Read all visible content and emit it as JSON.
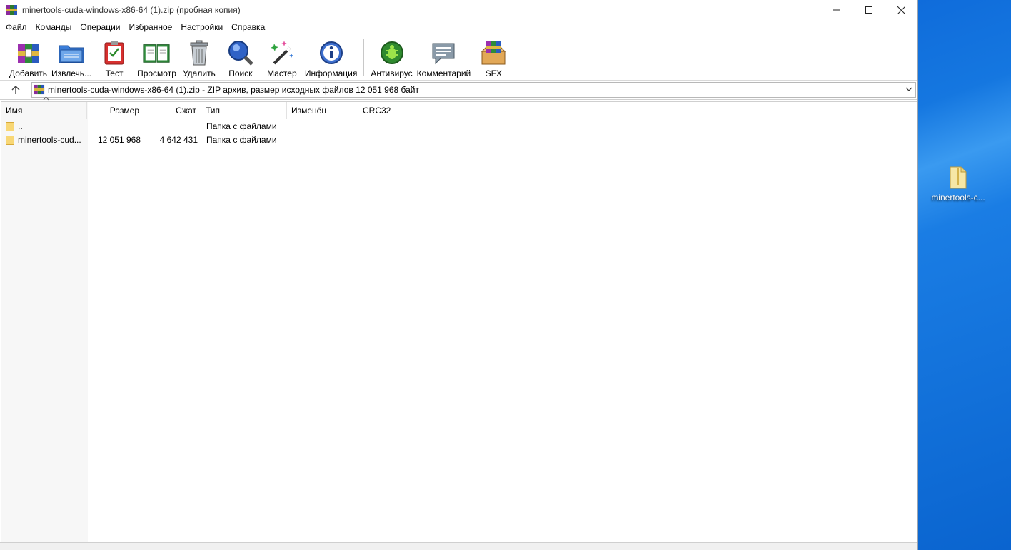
{
  "window": {
    "title": "minertools-cuda-windows-x86-64 (1).zip (пробная копия)"
  },
  "menu": [
    "Файл",
    "Команды",
    "Операции",
    "Избранное",
    "Настройки",
    "Справка"
  ],
  "toolbar": {
    "add": "Добавить",
    "extract": "Извлечь...",
    "test": "Тест",
    "view": "Просмотр",
    "delete": "Удалить",
    "find": "Поиск",
    "wizard": "Мастер",
    "info": "Информация",
    "antivirus": "Антивирус",
    "comment": "Комментарий",
    "sfx": "SFX"
  },
  "address": {
    "text": "minertools-cuda-windows-x86-64 (1).zip - ZIP архив, размер исходных файлов 12 051 968 байт"
  },
  "columns": {
    "name": "Имя",
    "size": "Размер",
    "packed": "Сжат",
    "type": "Тип",
    "modified": "Изменён",
    "crc": "CRC32"
  },
  "rows": [
    {
      "name": "..",
      "size": "",
      "packed": "",
      "type": "Папка с файлами"
    },
    {
      "name": "minertools-cud...",
      "size": "12 051 968",
      "packed": "4 642 431",
      "type": "Папка с файлами"
    }
  ],
  "desktop": {
    "icon_label": "minertools-c..."
  },
  "colors": {
    "desktop_blue": "#0a64cf",
    "folder_yellow": "#f8d775"
  }
}
